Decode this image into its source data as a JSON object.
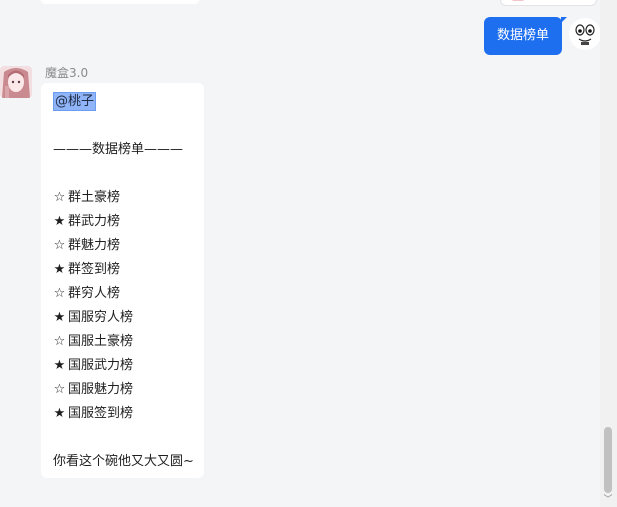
{
  "right_message": {
    "text": "数据榜单"
  },
  "left_message": {
    "sender": "魔盒3.0",
    "mention": "@桃子",
    "header": "———数据榜单———",
    "items": [
      {
        "star": "☆",
        "label": "群土豪榜"
      },
      {
        "star": "★",
        "label": "群武力榜"
      },
      {
        "star": "☆",
        "label": "群魅力榜"
      },
      {
        "star": "★",
        "label": "群签到榜"
      },
      {
        "star": "☆",
        "label": "群穷人榜"
      },
      {
        "star": "★",
        "label": "国服穷人榜"
      },
      {
        "star": "☆",
        "label": "国服土豪榜"
      },
      {
        "star": "★",
        "label": "国服武力榜"
      },
      {
        "star": "☆",
        "label": "国服魅力榜"
      },
      {
        "star": "★",
        "label": "国服签到榜"
      }
    ],
    "footer": "你看这个碗他又大又圆~"
  },
  "colors": {
    "accent": "#1e6ff0",
    "mention_highlight": "#8fb4f7",
    "background": "#f4f5f7"
  },
  "icons": {
    "scroll_down": "chevron-down-icon"
  }
}
